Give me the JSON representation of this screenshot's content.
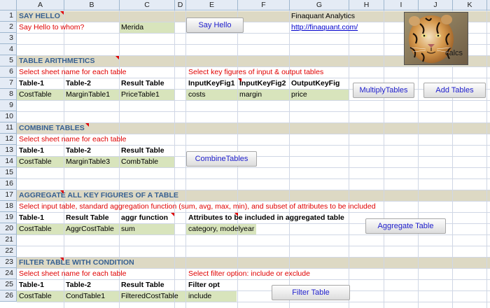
{
  "columns": [
    "A",
    "B",
    "C",
    "D",
    "E",
    "F",
    "G",
    "H",
    "I",
    "J",
    "K"
  ],
  "rows": [
    "1",
    "2",
    "3",
    "4",
    "5",
    "6",
    "7",
    "8",
    "9",
    "10",
    "11",
    "12",
    "13",
    "14",
    "15",
    "16",
    "17",
    "18",
    "19",
    "20",
    "21",
    "22",
    "23",
    "24",
    "25",
    "26"
  ],
  "say_hello": {
    "title": "SAY HELLO",
    "prompt": "Say Hello to whom?",
    "value": "Merida",
    "button": "Say Hello",
    "company": "Finaquant Analytics",
    "url": "http://finaquant.com/",
    "logo_caption": "calcs"
  },
  "table_arithmetics": {
    "title": "TABLE ARITHMETICS",
    "instr_sheet": "Select sheet name for each table",
    "instr_keys": "Select key figures of input & output tables",
    "headers": [
      "Table-1",
      "Table-2",
      "Result Table",
      "InputKeyFig1",
      "InputKeyFig2",
      "OutputKeyFig"
    ],
    "values": [
      "CostTable",
      "MarginTable1",
      "PriceTable1",
      "costs",
      "margin",
      "price"
    ],
    "btn_multiply": "MultiplyTables",
    "btn_add": "Add Tables"
  },
  "combine_tables": {
    "title": "COMBINE TABLES",
    "instr": "Select sheet name for each table",
    "headers": [
      "Table-1",
      "Table-2",
      "Result Table"
    ],
    "values": [
      "CostTable",
      "MarginTable3",
      "CombTable"
    ],
    "button": "CombineTables"
  },
  "aggregate": {
    "title": "AGGREGATE ALL KEY FIGURES OF A TABLE",
    "instr": "Select input table, standard aggregation function (sum, avg, max, min), and subset of attributes to be included",
    "headers": [
      "Table-1",
      "Result Table",
      "aggr function",
      "Attributes to be included in aggregated table"
    ],
    "values": [
      "CostTable",
      "AggrCostTable",
      "sum",
      "category, modelyear"
    ],
    "button": "Aggregate Table"
  },
  "filter": {
    "title": "FILTER TABLE WITH CONDITION",
    "instr_sheet": "Select sheet name for each table",
    "instr_opt": "Select filter option: include or exclude",
    "headers": [
      "Table-1",
      "Table-2",
      "Result Table",
      "Filter opt"
    ],
    "values": [
      "CostTable",
      "CondTable1",
      "FilteredCostTable",
      "include"
    ],
    "button": "Filter Table"
  },
  "colors": {
    "section_band": "#ddd9c4",
    "input_fill": "#d8e4bc",
    "title_text": "#376091",
    "instruction_text": "#e00000",
    "button_text": "#1d1dcc"
  }
}
